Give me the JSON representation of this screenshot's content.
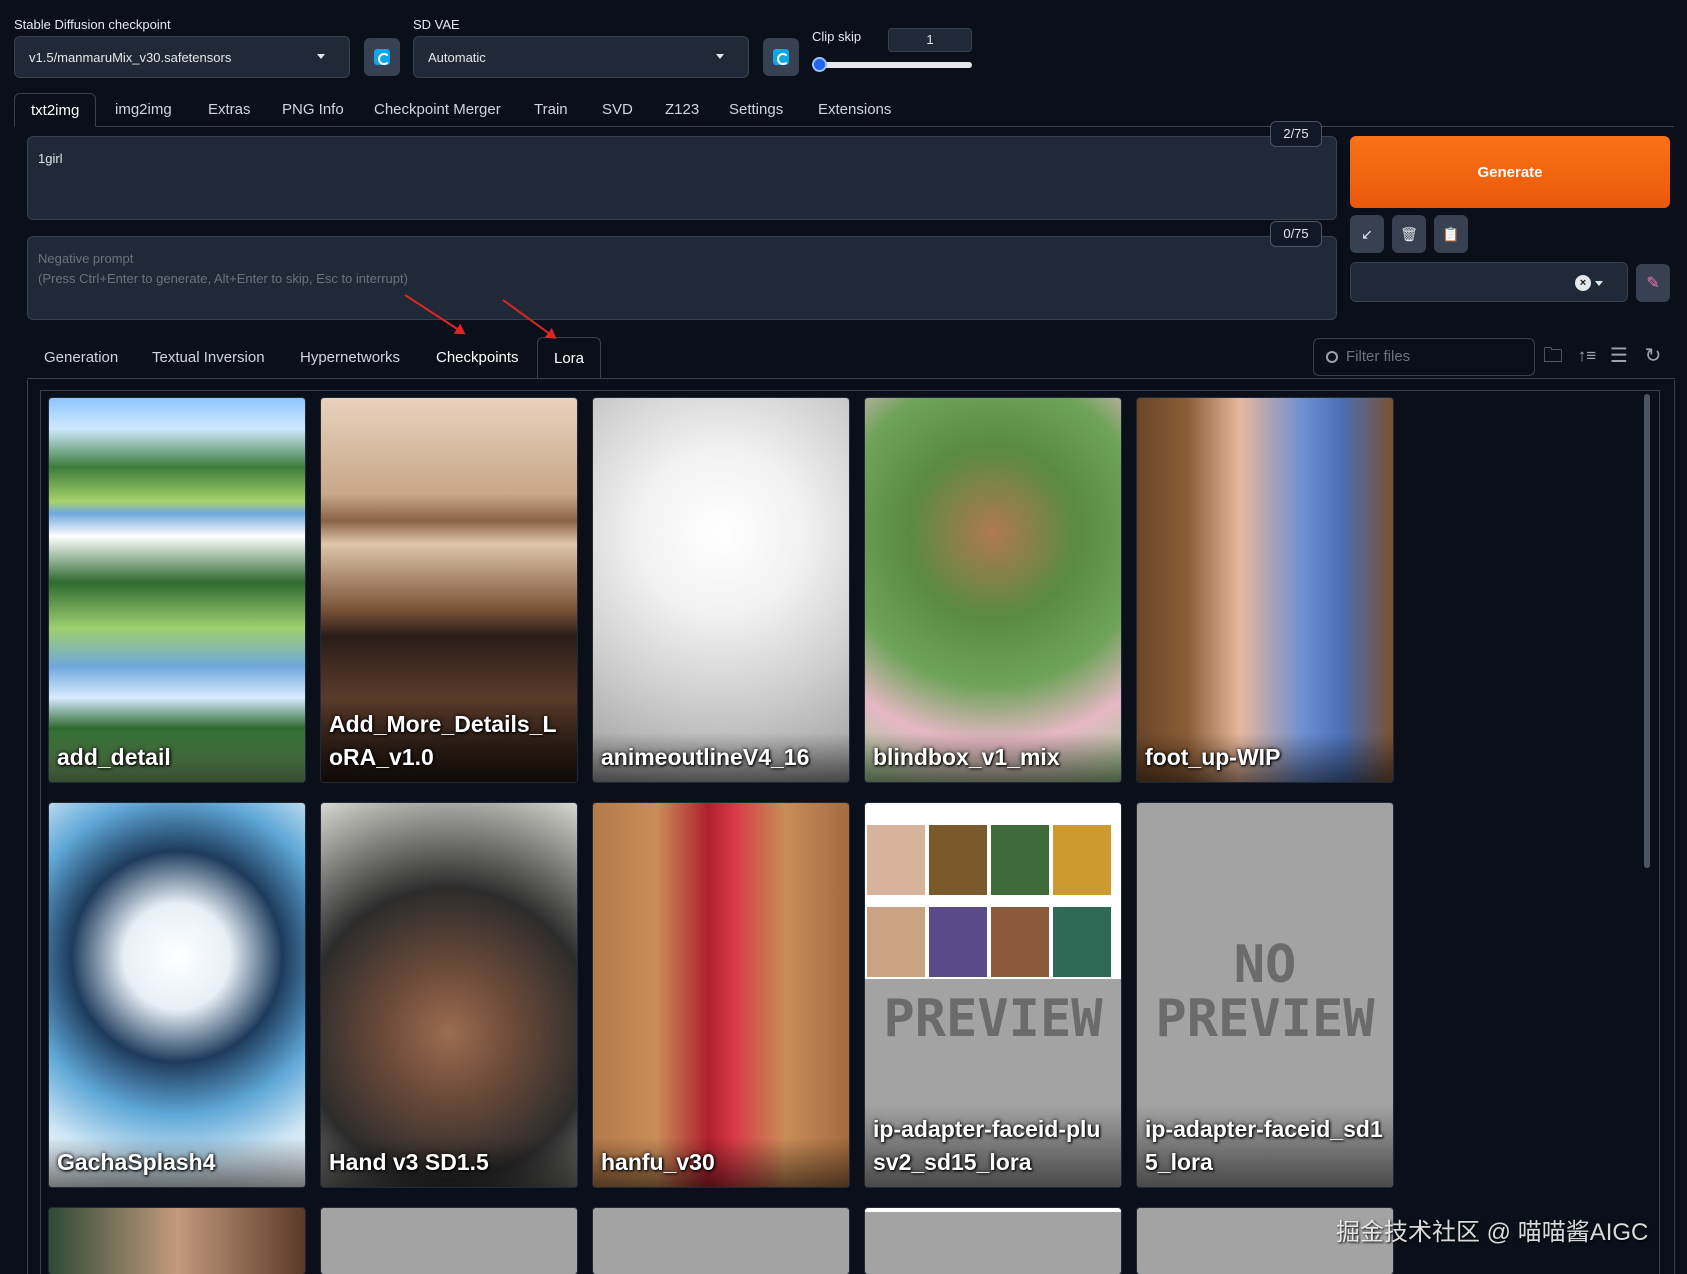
{
  "settings": {
    "checkpoint_label": "Stable Diffusion checkpoint",
    "checkpoint_value": "v1.5/manmaruMix_v30.safetensors",
    "vae_label": "SD VAE",
    "vae_value": "Automatic",
    "clip_skip_label": "Clip skip",
    "clip_skip_value": "1"
  },
  "main_tabs": [
    "txt2img",
    "img2img",
    "Extras",
    "PNG Info",
    "Checkpoint Merger",
    "Train",
    "SVD",
    "Z123",
    "Settings",
    "Extensions"
  ],
  "prompt": {
    "text": "1girl",
    "token_count": "2/75"
  },
  "negative_prompt": {
    "placeholder_line1": "Negative prompt",
    "placeholder_line2": "(Press Ctrl+Enter to generate, Alt+Enter to skip, Esc to interrupt)",
    "token_count": "0/75"
  },
  "actions": {
    "generate_label": "Generate"
  },
  "network_tabs": [
    "Generation",
    "Textual Inversion",
    "Hypernetworks",
    "Checkpoints",
    "Lora"
  ],
  "filter": {
    "placeholder": "Filter files"
  },
  "cards": [
    {
      "name": "add_detail"
    },
    {
      "name": "Add_More_Details_LoRA_v1.0"
    },
    {
      "name": "animeoutlineV4_16"
    },
    {
      "name": "blindbox_v1_mix"
    },
    {
      "name": "foot_up-WIP"
    },
    {
      "name": "GachaSplash4"
    },
    {
      "name": "Hand v3 SD1.5"
    },
    {
      "name": "hanfu_v30"
    },
    {
      "name": "ip-adapter-faceid-plusv2_sd15_lora"
    },
    {
      "name": "ip-adapter-faceid_sd15_lora"
    }
  ],
  "no_preview_text": {
    "line1": "NO",
    "line2": "PREVIEW"
  },
  "watermark": "掘金技术社区 @ 喵喵酱AIGC",
  "colors": {
    "background": "#0b0f19",
    "panel": "#1f2937",
    "border": "#374151",
    "generate": "#f97316",
    "annotation_arrow": "#dc2626"
  }
}
